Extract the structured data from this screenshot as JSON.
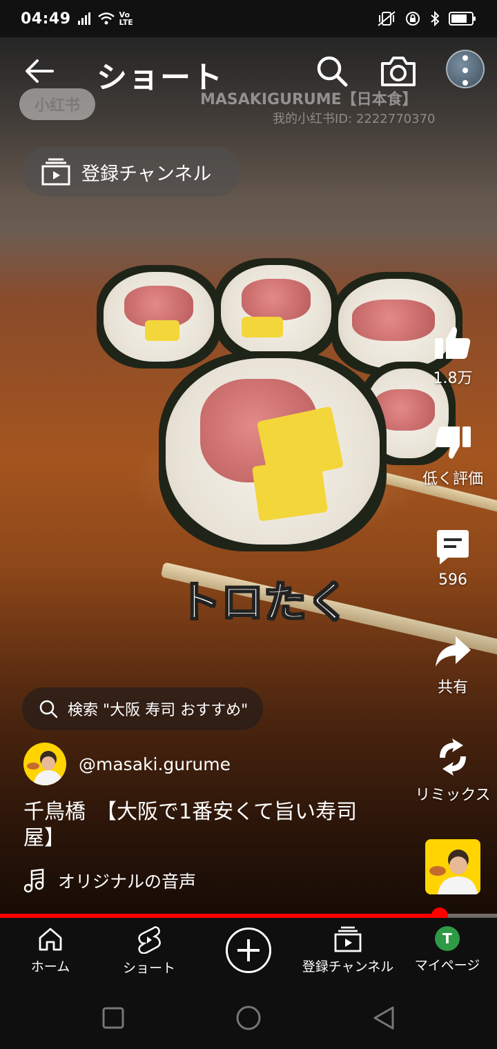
{
  "status_bar": {
    "time": "04:49",
    "network_label": "Vo LTE"
  },
  "top_bar": {
    "title": "ショート"
  },
  "video": {
    "watermark_name": "MASAKIGURUME【日本食】",
    "watermark_id": "我的小红书ID: 2222770370",
    "xhs_logo": "小红书",
    "overlay_caption": "トロたく"
  },
  "subscriptions_chip": {
    "label": "登録チャンネル"
  },
  "right_rail": {
    "like_count": "1.8万",
    "dislike_label": "低く評価",
    "comment_count": "596",
    "share_label": "共有",
    "remix_label": "リミックス"
  },
  "search_suggestion": {
    "text": "検索 \"大阪 寿司 おすすめ\""
  },
  "channel": {
    "handle": "@masaki.gurume"
  },
  "video_title": "千鳥橋　【大阪で1番安くて旨い寿司屋】",
  "audio": {
    "label": "オリジナルの音声"
  },
  "progress": {
    "fraction": 0.885
  },
  "bottom_nav": {
    "home": "ホーム",
    "shorts": "ショート",
    "subscriptions": "登録チャンネル",
    "my_page": "マイページ",
    "avatar_letter": "T"
  },
  "colors": {
    "accent": "#ff0000",
    "nav_bg": "#0f0f0f",
    "avatar_bg": "#2e9a46",
    "channel_bg": "#ffd400"
  }
}
